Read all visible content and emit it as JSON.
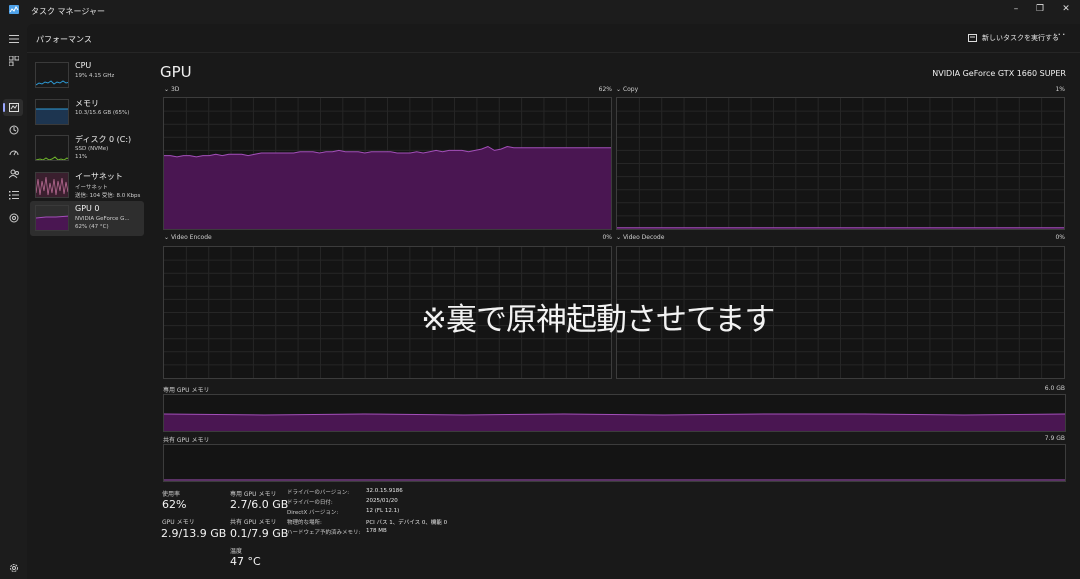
{
  "window": {
    "title": "タスク マネージャー"
  },
  "header": {
    "page_title": "パフォーマンス",
    "run_task_label": "新しいタスクを実行する",
    "more_label": "···"
  },
  "sidebar": {
    "items": [
      {
        "name": "CPU",
        "line1": "19% 4.15 GHz",
        "line2": ""
      },
      {
        "name": "メモリ",
        "line1": "10.3/15.6 GB (65%)",
        "line2": ""
      },
      {
        "name": "ディスク 0 (C:)",
        "line1": "SSD (NVMe)",
        "line2": "11%"
      },
      {
        "name": "イーサネット",
        "line1": "イーサネット",
        "line2": "送信: 104 受信: 8.0 Kbps"
      },
      {
        "name": "GPU 0",
        "line1": "NVIDIA GeForce G...",
        "line2": "62% (47 °C)"
      }
    ],
    "selected_index": 4
  },
  "gpu": {
    "title": "GPU",
    "model": "NVIDIA GeForce GTX 1660 SUPER",
    "engines": [
      {
        "label": "3D",
        "value": "62%"
      },
      {
        "label": "Copy",
        "value": "1%"
      },
      {
        "label": "Video Encode",
        "value": "0%"
      },
      {
        "label": "Video Decode",
        "value": "0%"
      }
    ],
    "dedicated_mem_label": "専用 GPU メモリ",
    "dedicated_mem_max": "6.0 GB",
    "shared_mem_label": "共有 GPU メモリ",
    "shared_mem_max": "7.9 GB"
  },
  "stats": {
    "usage_label": "使用率",
    "usage_value": "62%",
    "gpu_mem_label": "GPU メモリ",
    "gpu_mem_value": "2.9/13.9 GB",
    "dedicated_label": "専用 GPU メモリ",
    "dedicated_value": "2.7/6.0 GB",
    "shared_label": "共有 GPU メモリ",
    "shared_value": "0.1/7.9 GB",
    "temp_label": "温度",
    "temp_value": "47 °C"
  },
  "details": [
    {
      "key": "ドライバーのバージョン:",
      "value": "32.0.15.9186"
    },
    {
      "key": "ドライバーの日付:",
      "value": "2025/01/20"
    },
    {
      "key": "DirectX バージョン:",
      "value": "12 (FL 12.1)"
    },
    {
      "key": "物理的な場所:",
      "value": "PCI バス 1、デバイス 0、機能 0"
    },
    {
      "key": "ハードウェア予約済みメモリ:",
      "value": "178 MB"
    }
  ],
  "overlay_text": "※裏で原神起動させてます",
  "colors": {
    "accent": "#9aa7ff",
    "gpu_line": "#a24fb8",
    "gpu_fill": "#4a1652",
    "cpu": "#2d9ad6",
    "disk": "#6fb52c",
    "eth": "#b76b93"
  },
  "chart_data": {
    "type": "area",
    "title": "3D",
    "series": [
      {
        "name": "3D",
        "values": [
          56,
          56,
          55,
          56,
          56,
          55,
          56,
          56,
          57,
          56,
          57,
          57,
          57,
          56,
          57,
          58,
          58,
          58,
          58,
          58,
          58,
          59,
          59,
          59,
          58,
          59,
          59,
          60,
          59,
          59,
          59,
          58,
          59,
          59,
          59,
          59,
          58,
          58,
          58,
          59,
          58,
          59,
          60,
          59,
          60,
          60,
          60,
          59,
          60,
          61,
          63,
          60,
          61,
          63,
          62,
          62,
          62,
          62,
          62,
          62,
          62,
          62,
          62,
          62,
          62,
          62,
          62,
          62,
          62,
          62
        ]
      },
      {
        "name": "Copy",
        "values": [
          1,
          1,
          1,
          1,
          1,
          1,
          1,
          1,
          1,
          1,
          1,
          1,
          1,
          1,
          1,
          1,
          1,
          1,
          1,
          1,
          1,
          1,
          1,
          1,
          1,
          1,
          1,
          1,
          1,
          1,
          1,
          1,
          1,
          1,
          1,
          1,
          1,
          1,
          1,
          1,
          1,
          1,
          1,
          1,
          1,
          1,
          1,
          1,
          1,
          1,
          1,
          1,
          1,
          1,
          1,
          1,
          1,
          1,
          1,
          1,
          1,
          1,
          1,
          1,
          1,
          1,
          1,
          1,
          1,
          1
        ]
      }
    ],
    "ylim": [
      0,
      100
    ]
  }
}
